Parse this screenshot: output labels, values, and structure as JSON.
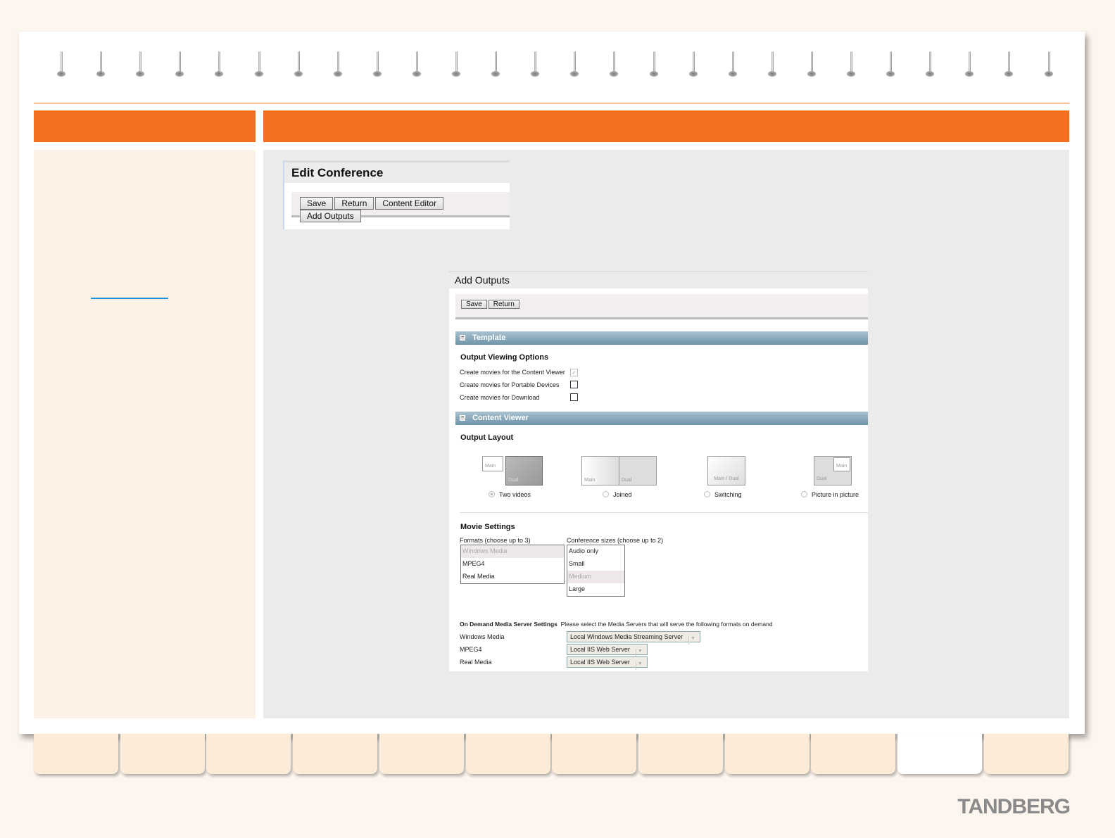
{
  "edit_conference": {
    "title": "Edit Conference",
    "buttons": [
      "Save",
      "Return",
      "Content Editor",
      "Add Outputs"
    ]
  },
  "add_outputs": {
    "title": "Add Outputs",
    "buttons": [
      "Save",
      "Return"
    ],
    "template_section": "Template",
    "output_viewing_options": {
      "heading": "Output Viewing Options",
      "options": [
        {
          "label": "Create movies for the Content Viewer",
          "checked": true,
          "disabled": true
        },
        {
          "label": "Create movies for Portable Devices",
          "checked": false
        },
        {
          "label": "Create movies for Download",
          "checked": false
        }
      ]
    },
    "content_viewer_section": "Content Viewer",
    "output_layout": {
      "heading": "Output Layout",
      "options": [
        {
          "label": "Two videos",
          "selected": true,
          "thumb": [
            "Main",
            "Dual"
          ]
        },
        {
          "label": "Joined",
          "selected": false,
          "thumb": [
            "Main",
            "Dual"
          ]
        },
        {
          "label": "Switching",
          "selected": false,
          "thumb": [
            "Main / Dual"
          ]
        },
        {
          "label": "Picture in picture",
          "selected": false,
          "thumb": [
            "Main",
            "Dual"
          ]
        }
      ]
    },
    "movie_settings": {
      "heading": "Movie Settings",
      "formats_label": "Formats (choose up to 3)",
      "formats": [
        "Windows Media",
        "MPEG4",
        "Real Media"
      ],
      "formats_selected": "Windows Media",
      "sizes_label": "Conference sizes (choose up to 2)",
      "sizes": [
        "Audio only",
        "Small",
        "Medium",
        "Large"
      ],
      "sizes_selected": "Medium"
    },
    "media_server": {
      "heading": "On Demand Media Server Settings",
      "note": "Please select the Media Servers that will serve the following formats on demand",
      "rows": [
        {
          "label": "Windows Media",
          "value": "Local Windows Media Streaming Server"
        },
        {
          "label": "MPEG4",
          "value": "Local IIS Web Server"
        },
        {
          "label": "Real Media",
          "value": "Local IIS Web Server"
        }
      ]
    }
  },
  "tabs": {
    "count": 12,
    "active_index": 10
  },
  "logo": "TANDBERG",
  "colors": {
    "accent": "#f37021",
    "section_header": "#6d93a8",
    "link": "#1a8fd8"
  }
}
